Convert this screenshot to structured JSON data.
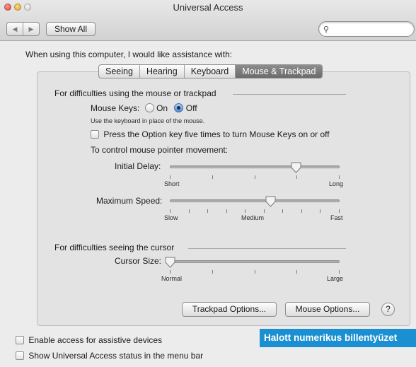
{
  "window": {
    "title": "Universal Access"
  },
  "toolbar": {
    "back_icon": "◀",
    "forward_icon": "▶",
    "show_all": "Show All",
    "search_value": ""
  },
  "prompt": "When using this computer, I would like assistance with:",
  "tabs": [
    {
      "label": "Seeing",
      "active": false
    },
    {
      "label": "Hearing",
      "active": false
    },
    {
      "label": "Keyboard",
      "active": false
    },
    {
      "label": "Mouse & Trackpad",
      "active": true
    }
  ],
  "mouse_group": {
    "title": "For difficulties using the mouse or trackpad",
    "mouse_keys_label": "Mouse Keys:",
    "on_label": "On",
    "off_label": "Off",
    "selected": "Off",
    "mouse_keys_help": "Use the keyboard in place of the mouse.",
    "option_key_label": "Press the Option key five times to turn Mouse Keys on or off",
    "option_key_checked": false,
    "pointer_heading": "To control mouse pointer movement:",
    "initial_delay": {
      "label": "Initial Delay:",
      "min_label": "Short",
      "max_label": "Long",
      "value": 0.74
    },
    "maximum_speed": {
      "label": "Maximum Speed:",
      "min_label": "Slow",
      "mid_label": "Medium",
      "max_label": "Fast",
      "value": 0.59
    }
  },
  "cursor_group": {
    "title": "For difficulties seeing the cursor",
    "cursor_size": {
      "label": "Cursor Size:",
      "min_label": "Normal",
      "max_label": "Large",
      "value": 0.0
    }
  },
  "buttons": {
    "trackpad_options": "Trackpad Options...",
    "mouse_options": "Mouse Options...",
    "help": "?"
  },
  "bottom": {
    "assistive": "Enable access for assistive devices",
    "assistive_checked": false,
    "status_menu": "Show Universal Access status in the menu bar",
    "status_menu_checked": false
  },
  "caption": "Halott numerikus billentyűzet"
}
